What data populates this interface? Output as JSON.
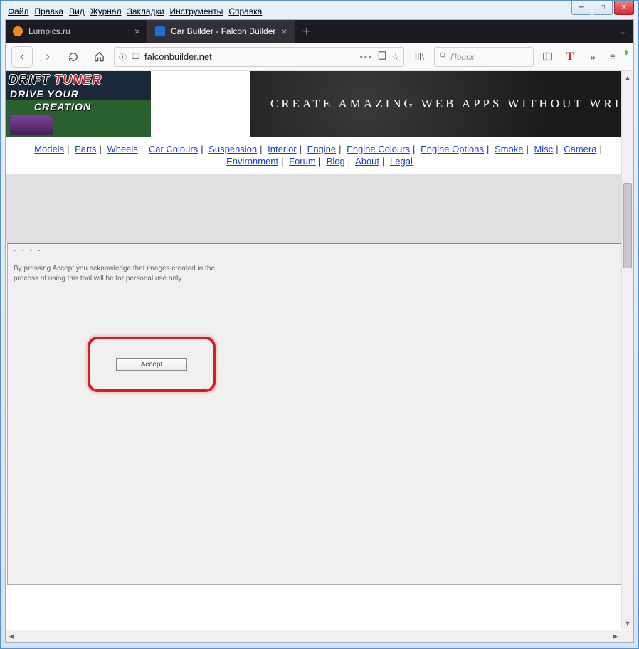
{
  "menubar": {
    "file": "Файл",
    "edit": "Правка",
    "view": "Вид",
    "history": "Журнал",
    "bookmarks": "Закладки",
    "tools": "Инструменты",
    "help": "Справка"
  },
  "tabs": [
    {
      "label": "Lumpics.ru",
      "icon": "orange"
    },
    {
      "label": "Car Builder - Falcon Builder",
      "icon": "grid",
      "active": true
    }
  ],
  "urlbar": {
    "url": "falconbuilder.net"
  },
  "search": {
    "placeholder": "Поиск"
  },
  "toolbar_t": "T",
  "game": {
    "line1_a": "DRIFT ",
    "line1_b": "TUNER",
    "line2": "DRIVE YOUR",
    "line3": "CREATION"
  },
  "banner": {
    "text": "CREATE AMAZING WEB APPS WITHOUT WRITING"
  },
  "nav": {
    "row1": [
      "Models",
      "Parts",
      "Wheels",
      "Car Colours",
      "Suspension",
      "Interior",
      "Engine",
      "Engine Colours",
      "Engine Options",
      "Smoke",
      "Misc",
      "Camera"
    ],
    "row2": [
      "Environment",
      "Forum",
      "Blog",
      "About",
      "Legal"
    ]
  },
  "panel": {
    "disclaimer": "By pressing Accept you acknowledge that images created in the process of using this tool will be for personal use only.",
    "accept": "Accept"
  }
}
